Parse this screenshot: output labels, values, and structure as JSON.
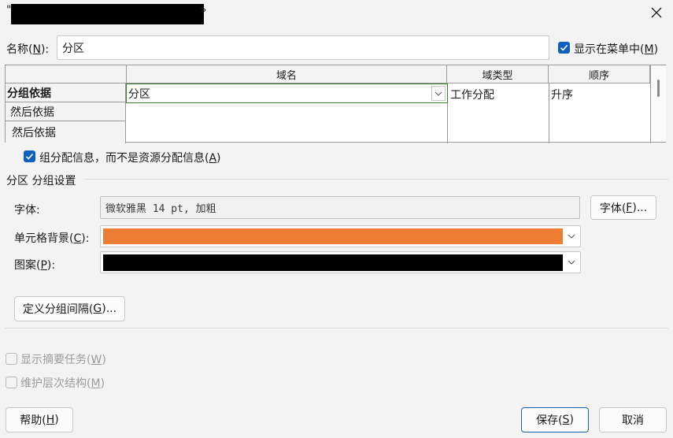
{
  "window": {
    "title_prefix": "\"",
    "title_suffix": "»"
  },
  "name_row": {
    "label": "名称(",
    "accel": "N",
    "label_end": "):",
    "value": "分区",
    "show_in_menu_label": "显示在菜单中(",
    "show_in_menu_accel": "M",
    "show_in_menu_end": ")",
    "show_in_menu_checked": true
  },
  "grid": {
    "headers": [
      "域名",
      "域类型",
      "顺序"
    ],
    "row_labels": [
      "分组依据",
      "然后依据",
      "然后依据"
    ],
    "rows": [
      {
        "field": "分区",
        "type": "工作分配",
        "order": "升序"
      }
    ]
  },
  "group_assignments": {
    "label": "组分配信息，而不是资源分配信息(",
    "accel": "A",
    "end": ")",
    "checked": true
  },
  "settings": {
    "section_title": "分区 分组设置",
    "font_label": "字体:",
    "font_value": "微软雅黑 14 pt, 加粗",
    "font_button": "字体(",
    "font_button_accel": "F",
    "font_button_end": ")...",
    "cell_bg_label": "单元格背景(",
    "cell_bg_accel": "C",
    "cell_bg_end": "):",
    "cell_bg_color": "#ed7d31",
    "pattern_label": "图案(",
    "pattern_accel": "P",
    "pattern_end": "):",
    "pattern_color": "#000000",
    "define_interval_button": "定义分组间隔(",
    "define_interval_accel": "G",
    "define_interval_end": ")..."
  },
  "options": {
    "summary_tasks": "显示摘要任务(",
    "summary_tasks_accel": "W",
    "summary_tasks_end": ")",
    "hierarchy": "维护层次结构(",
    "hierarchy_accel": "M",
    "hierarchy_end": ")"
  },
  "footer": {
    "help": "帮助(",
    "help_accel": "H",
    "help_end": ")",
    "save": "保存(",
    "save_accel": "S",
    "save_end": ")",
    "cancel": "取消"
  },
  "icons": {
    "close": "close-icon",
    "check": "checkmark-icon",
    "chevron": "chevron-down-icon"
  },
  "colors": {
    "accent": "#0f5fbf",
    "selected_cell_border": "#3a7f2e"
  }
}
